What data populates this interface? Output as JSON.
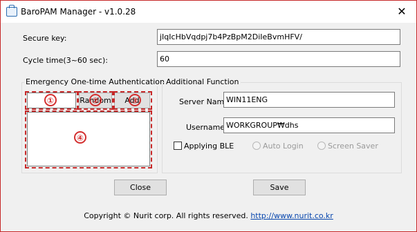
{
  "window": {
    "title": "BaroPAM Manager - v1.0.28",
    "close_glyph": "✕"
  },
  "secure_key": {
    "label": "Secure key:",
    "value": "jIqIcHbVqdpj7b4PzBpM2DiIeBvmHFV/"
  },
  "cycle_time": {
    "label": "Cycle time(3~60 sec):",
    "value": "60"
  },
  "emergency": {
    "title": "Emergency One-time Authentication Key",
    "otp_value": "",
    "random_label": "Random",
    "add_label": "Add",
    "key_list": "",
    "markers": [
      "①",
      "②",
      "③",
      "④"
    ]
  },
  "additional": {
    "title": "Additional Function",
    "server_name_label": "Server Name",
    "server_name_value": "WIN11ENG",
    "username_label": "Username",
    "username_value": "WORKGROUP₩dhs",
    "applying_ble_label": "Applying BLE",
    "auto_login_label": "Auto Login",
    "screen_saver_label": "Screen Saver"
  },
  "buttons": {
    "close_label": "Close",
    "save_label": "Save"
  },
  "footer": {
    "copyright": "Copyright © Nurit corp. All rights reserved.",
    "link": "http://www.nurit.co.kr"
  },
  "colors": {
    "annotation": "#d32f2f",
    "link": "#0645ad",
    "background": "#f0f0f0"
  }
}
